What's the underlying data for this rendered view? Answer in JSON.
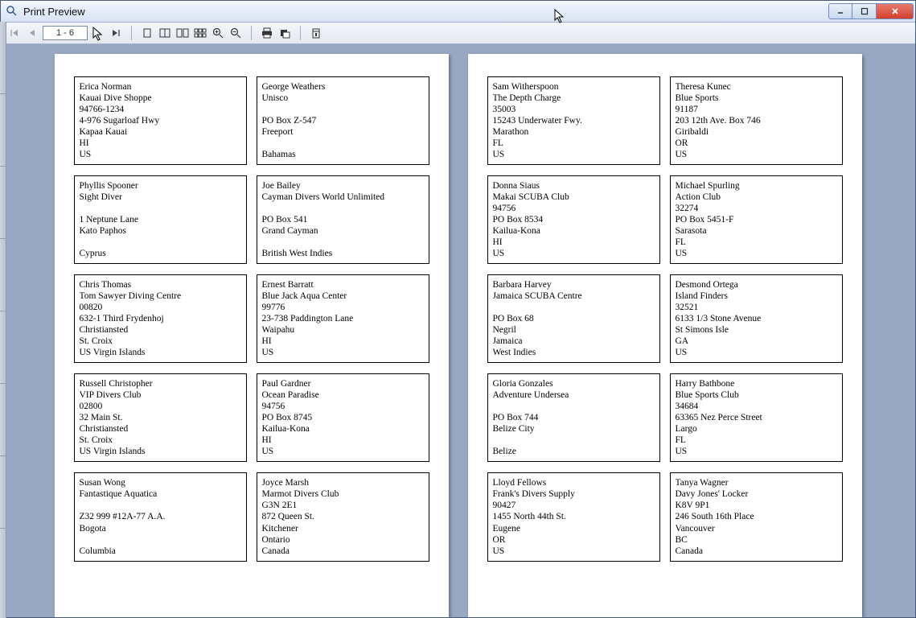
{
  "window": {
    "title": "Print Preview"
  },
  "toolbar": {
    "page_range": "1 - 6"
  },
  "pages": [
    [
      [
        "Erica Norman",
        "Kauai Dive Shoppe",
        "94766-1234",
        "4-976 Sugarloaf Hwy",
        "Kapaa Kauai",
        "HI",
        "US"
      ],
      [
        "George Weathers",
        "Unisco",
        "",
        "PO Box Z-547",
        "Freeport",
        "",
        "Bahamas"
      ],
      [
        "Phyllis Spooner",
        "Sight Diver",
        "",
        "1 Neptune Lane",
        "Kato Paphos",
        "",
        "Cyprus"
      ],
      [
        "Joe Bailey",
        "Cayman Divers World Unlimited",
        "",
        "PO Box 541",
        "Grand Cayman",
        "",
        "British West Indies"
      ],
      [
        "Chris Thomas",
        "Tom Sawyer Diving Centre",
        "00820",
        "632-1 Third Frydenhoj",
        "Christiansted",
        "St. Croix",
        "US Virgin Islands"
      ],
      [
        "Ernest Barratt",
        "Blue Jack Aqua Center",
        "99776",
        "23-738 Paddington Lane",
        "Waipahu",
        "HI",
        "US"
      ],
      [
        "Russell Christopher",
        "VIP Divers Club",
        "02800",
        "32 Main St.",
        "Christiansted",
        "St. Croix",
        "US Virgin Islands"
      ],
      [
        "Paul Gardner",
        "Ocean Paradise",
        "94756",
        "PO Box 8745",
        "Kailua-Kona",
        "HI",
        "US"
      ],
      [
        "Susan Wong",
        "Fantastique Aquatica",
        "",
        "Z32 999 #12A-77 A.A.",
        "Bogota",
        "",
        "Columbia"
      ],
      [
        "Joyce Marsh",
        "Marmot Divers Club",
        "G3N 2E1",
        "872 Queen St.",
        "Kitchener",
        "Ontario",
        "Canada"
      ]
    ],
    [
      [
        "Sam Witherspoon",
        "The Depth Charge",
        "35003",
        "15243 Underwater Fwy.",
        "Marathon",
        "FL",
        "US"
      ],
      [
        "Theresa Kunec",
        "Blue Sports",
        "91187",
        "203 12th Ave. Box 746",
        "Giribaldi",
        "OR",
        "US"
      ],
      [
        "Donna Siaus",
        "Makai SCUBA Club",
        "94756",
        "PO Box 8534",
        "Kailua-Kona",
        "HI",
        "US"
      ],
      [
        "Michael Spurling",
        "Action Club",
        "32274",
        "PO Box 5451-F",
        "Sarasota",
        "FL",
        "US"
      ],
      [
        "Barbara Harvey",
        "Jamaica SCUBA Centre",
        "",
        "PO Box 68",
        "Negril",
        "Jamaica",
        "West Indies"
      ],
      [
        "Desmond Ortega",
        "Island Finders",
        "32521",
        "6133 1/3 Stone Avenue",
        "St Simons Isle",
        "GA",
        "US"
      ],
      [
        "Gloria Gonzales",
        "Adventure Undersea",
        "",
        "PO Box 744",
        "Belize City",
        "",
        "Belize"
      ],
      [
        "Harry Bathbone",
        "Blue Sports Club",
        "34684",
        "63365 Nez Perce Street",
        "Largo",
        "FL",
        "US"
      ],
      [
        "Lloyd Fellows",
        "Frank's Divers Supply",
        "90427",
        "1455 North 44th St.",
        "Eugene",
        "OR",
        "US"
      ],
      [
        "Tanya Wagner",
        "Davy Jones' Locker",
        "K8V 9P1",
        "246 South 16th Place",
        "Vancouver",
        "BC",
        "Canada"
      ]
    ]
  ]
}
